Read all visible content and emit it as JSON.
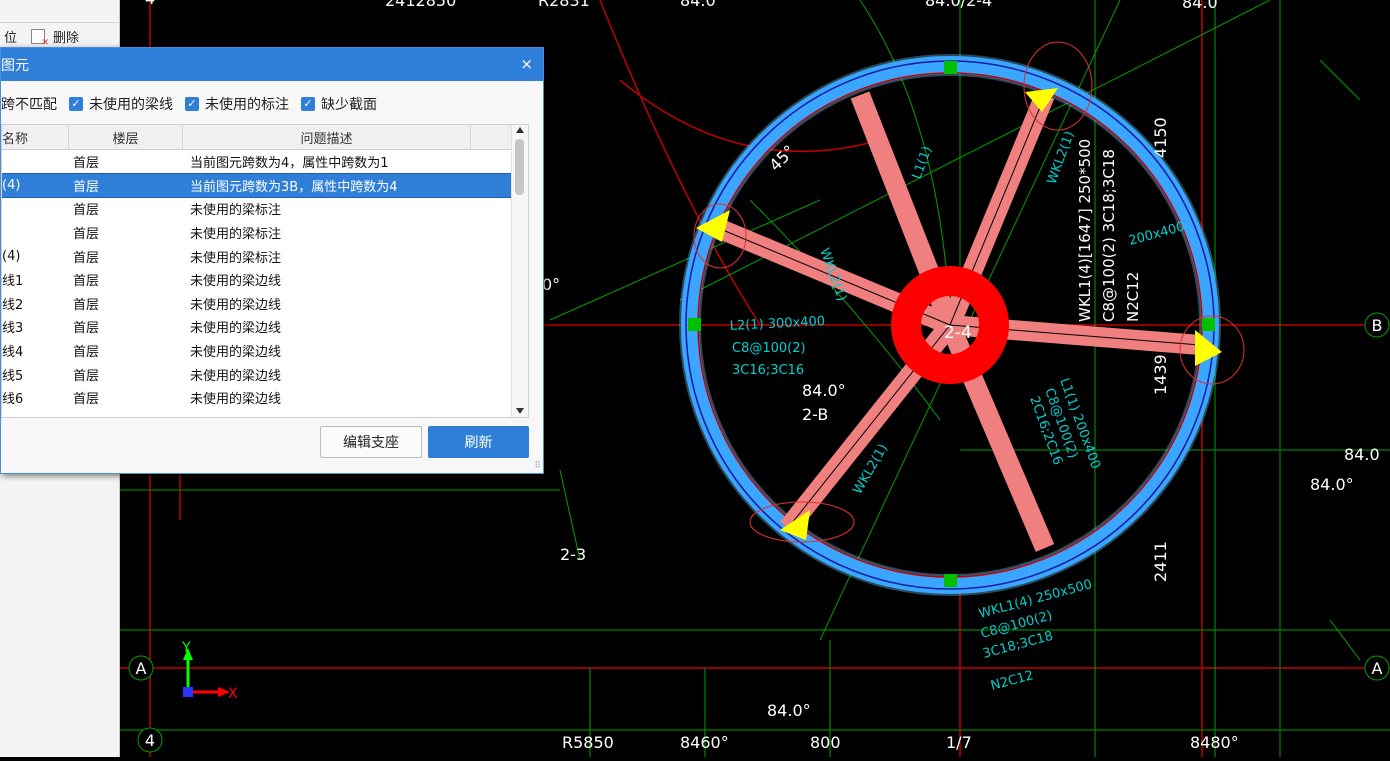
{
  "left_panel": {
    "toolbar": {
      "item1": "位",
      "delete_label": "删除"
    }
  },
  "dialog": {
    "title": "图元",
    "close": "×",
    "filters": [
      {
        "label": "跨不匹配",
        "checked": true
      },
      {
        "label": "未使用的梁线",
        "checked": true
      },
      {
        "label": "未使用的标注",
        "checked": true
      },
      {
        "label": "缺少截面",
        "checked": true
      }
    ],
    "columns": [
      "名称",
      "楼层",
      "问题描述"
    ],
    "rows": [
      {
        "name": "",
        "floor": "首层",
        "desc": "当前图元跨数为4，属性中跨数为1"
      },
      {
        "name": "(4)",
        "floor": "首层",
        "desc": "当前图元跨数为3B，属性中跨数为4"
      },
      {
        "name": "",
        "floor": "首层",
        "desc": "未使用的梁标注"
      },
      {
        "name": "",
        "floor": "首层",
        "desc": "未使用的梁标注"
      },
      {
        "name": "(4)",
        "floor": "首层",
        "desc": "未使用的梁标注"
      },
      {
        "name": "线1",
        "floor": "首层",
        "desc": "未使用的梁边线"
      },
      {
        "name": "线2",
        "floor": "首层",
        "desc": "未使用的梁边线"
      },
      {
        "name": "线3",
        "floor": "首层",
        "desc": "未使用的梁边线"
      },
      {
        "name": "线4",
        "floor": "首层",
        "desc": "未使用的梁边线"
      },
      {
        "name": "线5",
        "floor": "首层",
        "desc": "未使用的梁边线"
      },
      {
        "name": "线6",
        "floor": "首层",
        "desc": "未使用的梁边线"
      }
    ],
    "selected_row": 1,
    "buttons": {
      "edit_support": "编辑支座",
      "refresh": "刷新"
    }
  },
  "cad": {
    "colors": {
      "axis": "#c00000",
      "green": "#00a000",
      "ring": "#1e90ff",
      "beam": "#f08080",
      "column": "#ff0000",
      "cyan": "#00d0d0",
      "text": "#ffffff",
      "yellow": "#ffff00"
    },
    "labels": {
      "top1": "2412850",
      "top2": "R2831",
      "top3": "84.0",
      "top4": "84.0/2-4",
      "top5": "84.0",
      "angle45": "45°",
      "angle0": "0°",
      "wkl1_vert": "WKL1(4)[1647] 250*500",
      "c8_vert": "C8@100(2) 3C18;3C18",
      "n2c12": "N2C12",
      "dim4150": "4150",
      "dim1439": "1439",
      "dim2411": "2411",
      "center": "2-4",
      "mid840": "84.0°",
      "node2b": "2-B",
      "node23": "2-3",
      "l1": "L1(1)",
      "wkl2_a": "WKL2(1)",
      "wkl2_b": "WKL2(1)",
      "wkl2_c": "WKL2(1)",
      "l2_1": "L2(1) 300x400",
      "l2_2": "C8@100(2)",
      "l2_3": "3C16;3C16",
      "r200": "200x400",
      "l1b": "L1(1) 200x400",
      "c8b": "C8@100(2)",
      "c16b": "2C16;2C16",
      "wkl1_1": "WKL1(4) 250x500",
      "wkl1_2": "C8@100(2)",
      "wkl1_3": "3C18;3C18",
      "wkl1_4": "N2C12",
      "b_right": "B",
      "a_left": "A",
      "a_right": "A",
      "n4_top": "4",
      "n4_bot": "4",
      "r84_1": "84.0",
      "r84_2": "84.0°",
      "b840": "84.0°",
      "bot1": "R5850",
      "bot2": "8460°",
      "bot3": "800",
      "bot4": "1/7",
      "bot5": "8480°",
      "axis_x": "X",
      "axis_y": "Y"
    }
  }
}
